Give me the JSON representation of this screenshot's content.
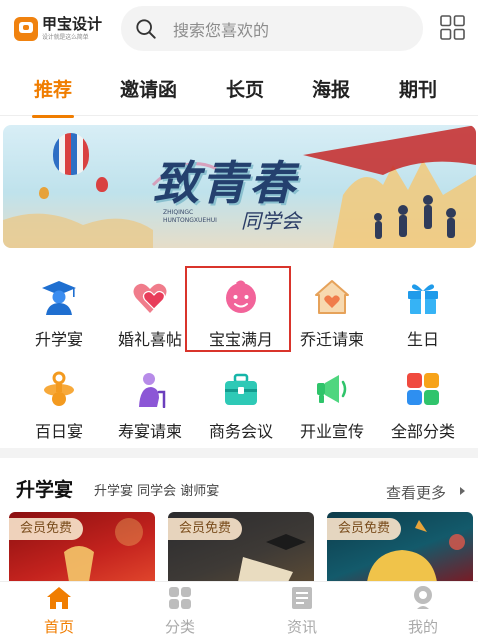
{
  "header": {
    "logo_name": "甲宝设计",
    "logo_slogan": "设计就是这么简单",
    "search_placeholder": "搜索您喜欢的"
  },
  "tabs": [
    {
      "label": "推荐",
      "active": true
    },
    {
      "label": "邀请函",
      "active": false
    },
    {
      "label": "长页",
      "active": false
    },
    {
      "label": "海报",
      "active": false
    },
    {
      "label": "期刊",
      "active": false
    }
  ],
  "banner": {
    "title": "致青春",
    "subtitle": "同学会",
    "pinyin": "ZHIQINGC HUNTONGXUEHUI"
  },
  "categories": [
    {
      "label": "升学宴",
      "icon": "graduate-icon"
    },
    {
      "label": "婚礼喜帖",
      "icon": "hearts-icon"
    },
    {
      "label": "宝宝满月",
      "icon": "baby-icon"
    },
    {
      "label": "乔迁请柬",
      "icon": "house-heart-icon"
    },
    {
      "label": "生日",
      "icon": "gift-icon"
    },
    {
      "label": "百日宴",
      "icon": "pacifier-icon"
    },
    {
      "label": "寿宴请柬",
      "icon": "elder-icon"
    },
    {
      "label": "商务会议",
      "icon": "briefcase-icon"
    },
    {
      "label": "开业宣传",
      "icon": "megaphone-icon"
    },
    {
      "label": "全部分类",
      "icon": "all-categories-icon"
    }
  ],
  "section": {
    "title": "升学宴",
    "subtitle": "升学宴 同学会 谢师宴",
    "more": "查看更多"
  },
  "cards": [
    {
      "badge": "会员免费"
    },
    {
      "badge": "会员免费"
    },
    {
      "badge": "会员免费"
    }
  ],
  "bottom_nav": [
    {
      "label": "首页",
      "active": true
    },
    {
      "label": "分类",
      "active": false
    },
    {
      "label": "资讯",
      "active": false
    },
    {
      "label": "我的",
      "active": false
    }
  ],
  "colors": {
    "accent": "#f07d00",
    "highlight_border": "#d9342b"
  }
}
